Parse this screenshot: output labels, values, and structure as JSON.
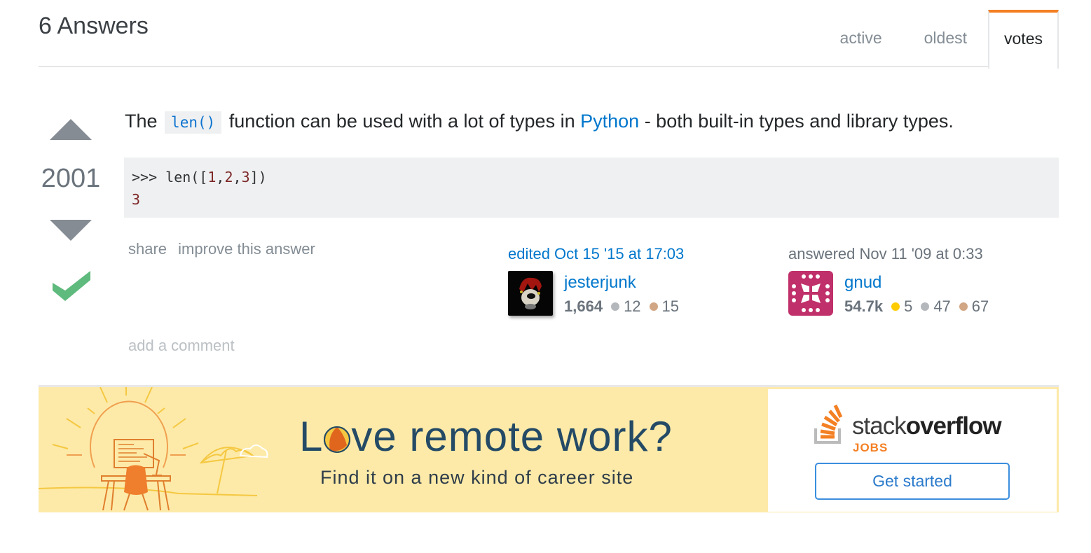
{
  "header": {
    "title": "6 Answers",
    "tabs": [
      {
        "label": "active",
        "active": false
      },
      {
        "label": "oldest",
        "active": false
      },
      {
        "label": "votes",
        "active": true
      }
    ]
  },
  "answer": {
    "votes": "2001",
    "accepted": true,
    "text": {
      "before_code": "The",
      "inline_code": "len()",
      "middle": "function can be used with a lot of types in",
      "link": "Python",
      "after": "- both built-in types and library types."
    },
    "code": {
      "line1_prompt": ">>> len([",
      "line1_n1": "1",
      "line1_c1": ",",
      "line1_n2": "2",
      "line1_c2": ",",
      "line1_n3": "3",
      "line1_end": "])",
      "line2": "3"
    },
    "menu": {
      "share": "share",
      "improve": "improve this answer"
    },
    "editor": {
      "action": "edited Oct 15 '15 at 17:03",
      "name": "jesterjunk",
      "reputation": "1,664",
      "silver": "12",
      "bronze": "15"
    },
    "author": {
      "action": "answered Nov 11 '09 at 0:33",
      "name": "gnud",
      "reputation": "54.7k",
      "gold": "5",
      "silver": "47",
      "bronze": "67"
    },
    "add_comment": "add a comment"
  },
  "ad": {
    "headline_l": "L",
    "headline_rest": "ve remote work?",
    "subtitle": "Find it on a new kind of career site",
    "brand_light": "stack",
    "brand_bold": "overflow",
    "brand_sub": "JOBS",
    "cta": "Get started"
  },
  "colors": {
    "accent_tab": "#f48024",
    "link": "#0077cc",
    "accepted": "#5eba7d",
    "gold": "#ffcc01",
    "silver": "#b4b8bc",
    "bronze": "#d1a684",
    "ad_bg": "#fdeaa8"
  }
}
